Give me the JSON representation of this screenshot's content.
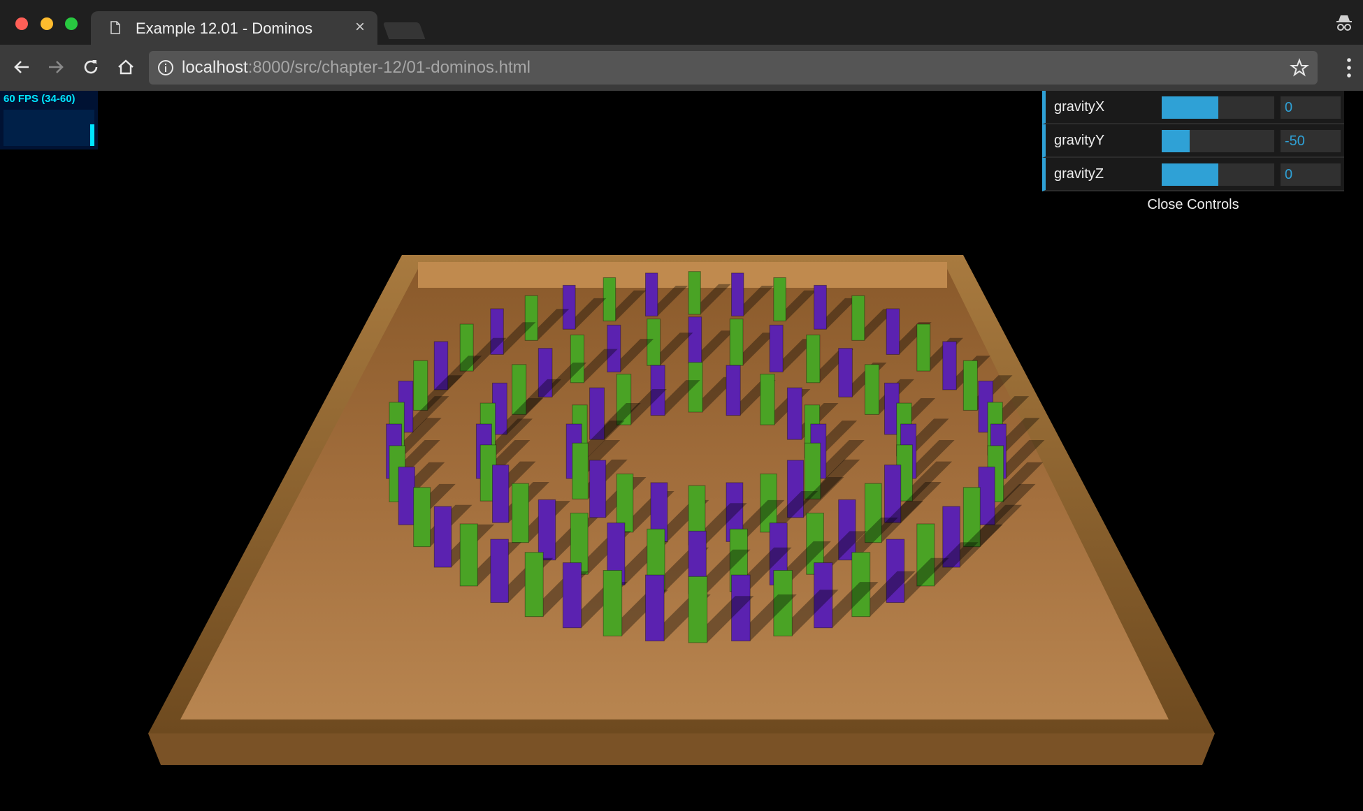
{
  "browser": {
    "tab_title": "Example 12.01 - Dominos",
    "url_host": "localhost",
    "url_rest": ":8000/src/chapter-12/01-dominos.html"
  },
  "stats": {
    "label": "60 FPS (34-60)",
    "fps_level": 0.6
  },
  "controls": {
    "rows": [
      {
        "label": "gravityX",
        "value": "0",
        "fill": 0.5
      },
      {
        "label": "gravityY",
        "value": "-50",
        "fill": 0.25
      },
      {
        "label": "gravityZ",
        "value": "0",
        "fill": 0.5
      }
    ],
    "close_label": "Close Controls",
    "accent": "#2fa1d6"
  },
  "scene": {
    "domino_colors": [
      "#5b22b0",
      "#4aa325"
    ],
    "board_color": "#a9743b",
    "frame_color": "#8b5e28"
  }
}
